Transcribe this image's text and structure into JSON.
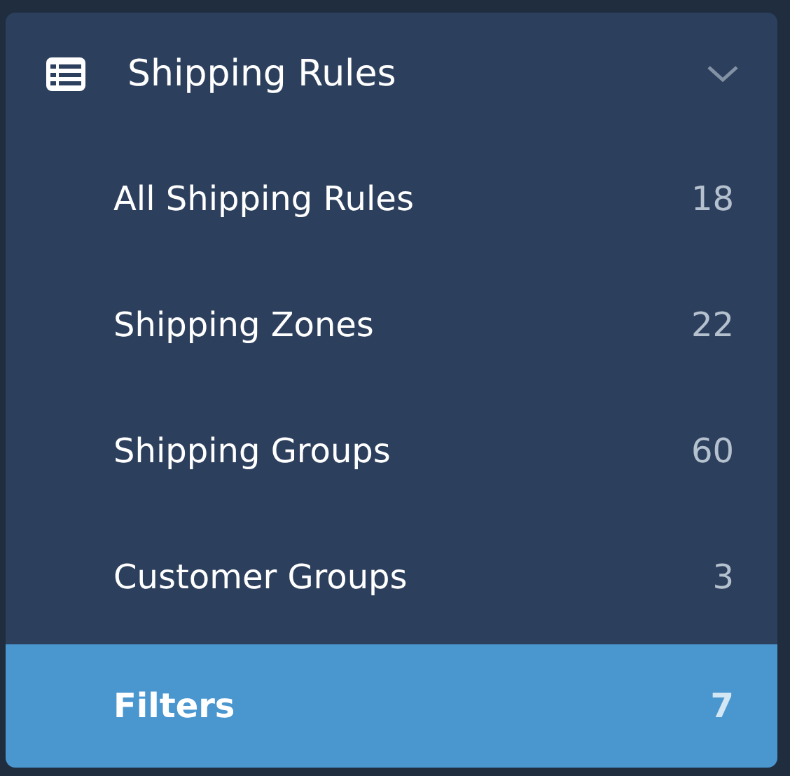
{
  "section": {
    "title": "Shipping Rules",
    "expanded": true,
    "items": [
      {
        "label": "All Shipping Rules",
        "count": "18",
        "selected": false
      },
      {
        "label": "Shipping Zones",
        "count": "22",
        "selected": false
      },
      {
        "label": "Shipping Groups",
        "count": "60",
        "selected": false
      },
      {
        "label": "Customer Groups",
        "count": "3",
        "selected": false
      },
      {
        "label": "Filters",
        "count": "7",
        "selected": true
      }
    ]
  }
}
